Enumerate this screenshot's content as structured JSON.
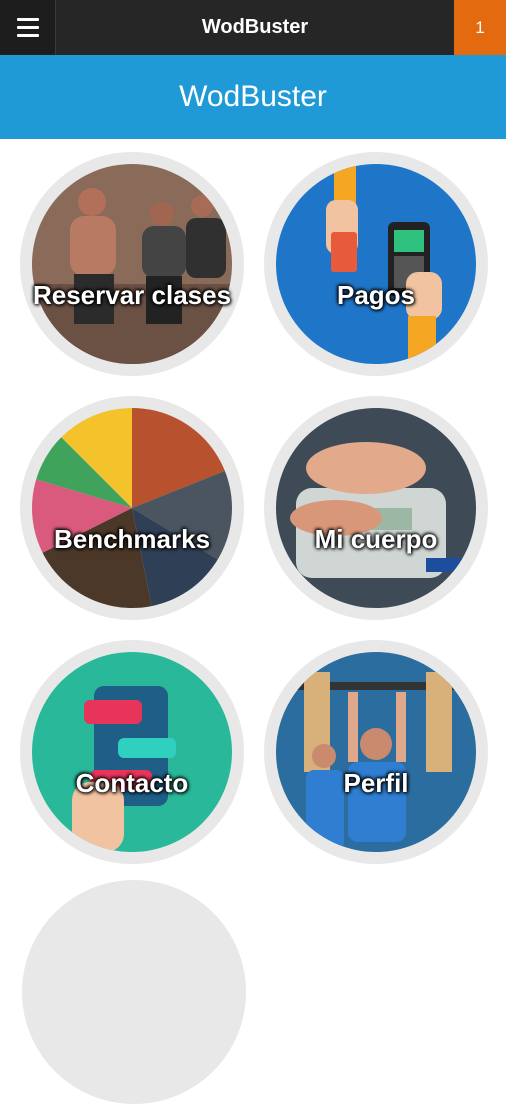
{
  "topbar": {
    "title": "WodBuster",
    "notification_count": "1",
    "menu_icon": "hamburger-menu-icon"
  },
  "header": {
    "title": "WodBuster"
  },
  "tiles": [
    {
      "label": "Reservar clases"
    },
    {
      "label": "Pagos"
    },
    {
      "label": "Benchmarks"
    },
    {
      "label": "Mi cuerpo"
    },
    {
      "label": "Contacto"
    },
    {
      "label": "Perfil"
    }
  ],
  "colors": {
    "topbar": "#262626",
    "header": "#1f9ad7",
    "badge": "#e46a10"
  }
}
